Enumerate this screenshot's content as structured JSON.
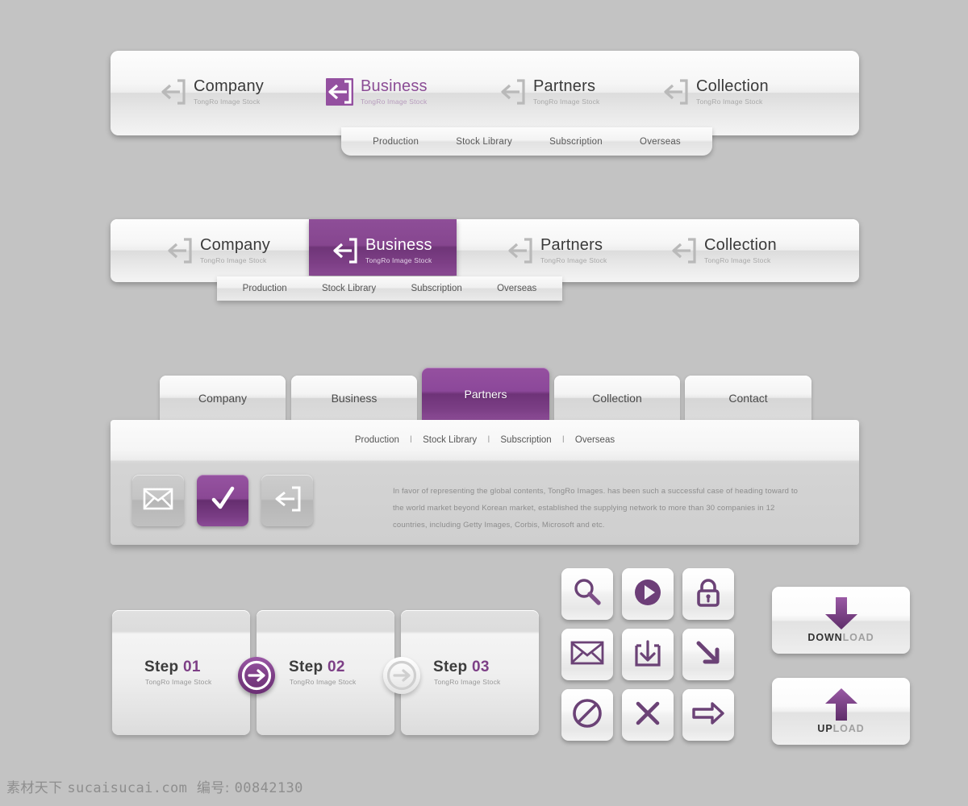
{
  "theme": {
    "background": "#c3c3c3",
    "accent_purple": "#7d3f86",
    "accent_purple_light": "#9550a0",
    "text_dark": "#3a3a3a",
    "text_muted": "#8d8d8d"
  },
  "nav1": {
    "items": [
      {
        "name": "Company",
        "sub": "TongRo Image Stock",
        "icon": "enter-arrow-icon",
        "active": false
      },
      {
        "name": "Business",
        "sub": "TongRo Image Stock",
        "icon": "enter-arrow-icon",
        "active": true
      },
      {
        "name": "Partners",
        "sub": "TongRo Image Stock",
        "icon": "enter-arrow-icon",
        "active": false
      },
      {
        "name": "Collection",
        "sub": "TongRo Image Stock",
        "icon": "enter-arrow-icon",
        "active": false
      }
    ],
    "submenu": [
      "Production",
      "Stock Library",
      "Subscription",
      "Overseas"
    ]
  },
  "nav2": {
    "items": [
      {
        "name": "Company",
        "sub": "TongRo Image Stock",
        "icon": "enter-arrow-icon",
        "active": false
      },
      {
        "name": "Business",
        "sub": "TongRo Image Stock",
        "icon": "enter-arrow-icon",
        "active": true
      },
      {
        "name": "Partners",
        "sub": "TongRo Image Stock",
        "icon": "enter-arrow-icon",
        "active": false
      },
      {
        "name": "Collection",
        "sub": "TongRo Image Stock",
        "icon": "enter-arrow-icon",
        "active": false
      }
    ],
    "submenu": [
      "Production",
      "Stock Library",
      "Subscription",
      "Overseas"
    ]
  },
  "tabs": {
    "items": [
      {
        "label": "Company",
        "active": false
      },
      {
        "label": "Business",
        "active": false
      },
      {
        "label": "Partners",
        "active": true
      },
      {
        "label": "Collection",
        "active": false
      },
      {
        "label": "Contact",
        "active": false
      }
    ],
    "submenu": [
      "Production",
      "Stock Library",
      "Subscription",
      "Overseas"
    ],
    "separator": "I",
    "panel": {
      "icons": [
        {
          "name": "mail-icon",
          "active": false
        },
        {
          "name": "check-icon",
          "active": true
        },
        {
          "name": "enter-arrow-icon",
          "active": false
        }
      ],
      "body": "In favor of representing the global contents, TongRo Images. has been such a successful case of heading toward to the world market beyond Korean market, established the supplying network to more than 30 companies in 12 countries, including Getty Images, Corbis, Microsoft and etc."
    }
  },
  "steps": {
    "items": [
      {
        "label": "Step",
        "number": "01",
        "sub": "TongRo Image Stock"
      },
      {
        "label": "Step",
        "number": "02",
        "sub": "TongRo Image Stock"
      },
      {
        "label": "Step",
        "number": "03",
        "sub": "TongRo Image Stock"
      }
    ],
    "connectors": [
      {
        "name": "arrow-right-circle-icon",
        "state": "active"
      },
      {
        "name": "arrow-right-circle-icon",
        "state": "inactive"
      }
    ]
  },
  "icon_grid": [
    {
      "name": "search-icon",
      "style": "outline"
    },
    {
      "name": "play-circle-icon",
      "style": "filled"
    },
    {
      "name": "lock-icon",
      "style": "outline"
    },
    {
      "name": "mail-icon",
      "style": "outline"
    },
    {
      "name": "download-tray-icon",
      "style": "outline"
    },
    {
      "name": "arrow-down-right-icon",
      "style": "outline"
    },
    {
      "name": "prohibited-icon",
      "style": "outline"
    },
    {
      "name": "close-x-icon",
      "style": "outline"
    },
    {
      "name": "arrow-right-icon",
      "style": "outline"
    }
  ],
  "action_buttons": [
    {
      "icon": "arrow-down-icon",
      "label_bold": "DOWN",
      "label_light": "LOAD"
    },
    {
      "icon": "arrow-up-icon",
      "label_bold": "UP",
      "label_light": "LOAD"
    }
  ],
  "footer": {
    "site_cn": "素材天下",
    "site_url": "sucaisucai.com",
    "id_label": "编号:",
    "id_value": "00842130"
  }
}
